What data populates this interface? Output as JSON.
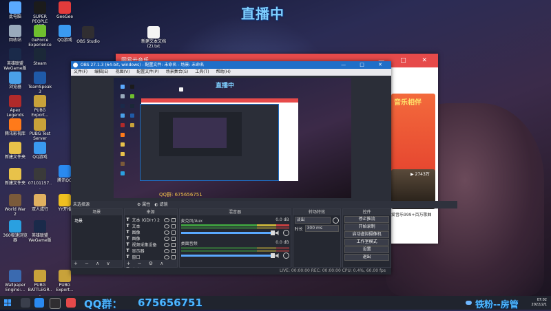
{
  "overlay": {
    "title": "直播中"
  },
  "desktop": {
    "icons": [
      {
        "label": "此电脑",
        "color": "#5aa9ff"
      },
      {
        "label": "SUPER PEOPLE CBT",
        "color": "#1b1b1b"
      },
      {
        "label": "GeeGee",
        "color": "#e33b3b"
      },
      {
        "label": "回收站",
        "color": "#9ab"
      },
      {
        "label": "GeForce Experience",
        "color": "#6fbf2e"
      },
      {
        "label": "QQ游戏",
        "color": "#3a9af0"
      },
      {
        "label": "英雄联盟 WeGame版",
        "color": "#1a2a4a"
      },
      {
        "label": "Steam",
        "color": "#1b2838"
      },
      {
        "label": "浏览器",
        "color": "#4aa0e8"
      },
      {
        "label": "TeamSpeak 3",
        "color": "#1f5aa8"
      },
      {
        "label": "Apex Legends",
        "color": "#b02a2a"
      },
      {
        "label": "PUBG Export...",
        "color": "#c8a23a"
      },
      {
        "label": "腾讯影视库",
        "color": "#ff7a1a"
      },
      {
        "label": "PUBG Test Server",
        "color": "#c8a23a"
      },
      {
        "label": "新建文件夹",
        "color": "#e8c24a"
      },
      {
        "label": "QQ游戏",
        "color": "#3a9af0"
      },
      {
        "label": "20200801...",
        "color": "#3a3a3a"
      },
      {
        "label": "新建文件夹",
        "color": "#e8c24a"
      },
      {
        "label": "07101157...",
        "color": "#3a3a3a"
      },
      {
        "label": "腾讯QQ",
        "color": "#2a8af0"
      },
      {
        "label": "World War 2",
        "color": "#7a5a3a"
      },
      {
        "label": "双人成行",
        "color": "#e0b060"
      },
      {
        "label": "360极速浏览器",
        "color": "#2aa0e0"
      },
      {
        "label": "英雄联盟 WeGame版",
        "color": "#1a2a4a"
      },
      {
        "label": "YY开播",
        "color": "#f0c020"
      },
      {
        "label": "Wallpaper Engine:...",
        "color": "#3a6ab0"
      },
      {
        "label": "PUBG BATTLEGR...",
        "color": "#c8a23a"
      },
      {
        "label": "PUBG Export...",
        "color": "#c8a23a"
      },
      {
        "label": "新建文本文档 (2).txt",
        "color": "#f4f4f4"
      },
      {
        "label": "OBS Studio",
        "color": "#302e31"
      }
    ]
  },
  "music_window": {
    "title": "网易云音乐"
  },
  "obs": {
    "title": "OBS 27.1.3 (64-bit, windows) - 配置文件: 未命名 - 场景: 未命名",
    "menu": [
      "文件(F)",
      "编辑(E)",
      "视图(V)",
      "配置文件(P)",
      "场景集合(S)",
      "工具(T)",
      "帮助(H)"
    ],
    "preview_title": "直播中",
    "preview_caption": "QQ群: 675656751",
    "tabs": {
      "no_source": "未选择源",
      "properties": "属性",
      "filters": "滤镜"
    },
    "docks": {
      "scenes": "场景",
      "sources": "来源",
      "mixer": "混音器",
      "transitions": "转场特效",
      "controls": "控件"
    },
    "scenes": [
      "场景"
    ],
    "sources": [
      {
        "name": "文本 (GDI+) 2"
      },
      {
        "name": "文本"
      },
      {
        "name": "图像"
      },
      {
        "name": "图像"
      },
      {
        "name": "视频采集设备"
      },
      {
        "name": "显示器"
      },
      {
        "name": "窗口"
      },
      {
        "name": "文本"
      },
      {
        "name": "文本"
      }
    ],
    "mixer": [
      {
        "name": "麦克风/Aux",
        "db": "0.0 dB"
      },
      {
        "name": "桌面音频",
        "db": "0.0 dB"
      }
    ],
    "transition": {
      "type": "淡出",
      "duration_label": "时长",
      "duration": "300 ms"
    },
    "controls": [
      "停止推流",
      "开始录制",
      "启动虚拟摄像机",
      "工作室模式",
      "设置",
      "退出"
    ],
    "status": "LIVE: 00:00:00   REC: 00:00:00   CPU: 0.4%, 60.00 fps"
  },
  "taskbar": {
    "qq_label": "QQ群：",
    "qq_number": "675656751",
    "overlay_right": "铁粉--房管",
    "time": "07:02",
    "date": "2022/2/1",
    "temp": "7°C"
  }
}
